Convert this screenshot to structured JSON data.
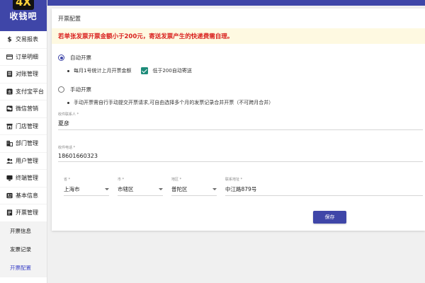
{
  "sidebar": {
    "logo_mark": "4X",
    "logo_text": "收钱吧",
    "items": [
      {
        "label": "交易报表",
        "icon": "dollar-icon"
      },
      {
        "label": "订单明细",
        "icon": "card-icon"
      },
      {
        "label": "对账管理",
        "icon": "ledger-icon"
      },
      {
        "label": "支付宝平台",
        "icon": "alipay-icon"
      },
      {
        "label": "微信营销",
        "icon": "wechat-icon"
      },
      {
        "label": "门店管理",
        "icon": "store-icon"
      },
      {
        "label": "部门管理",
        "icon": "building-icon"
      },
      {
        "label": "用户管理",
        "icon": "users-icon"
      },
      {
        "label": "终端管理",
        "icon": "terminal-icon"
      },
      {
        "label": "基本信息",
        "icon": "info-icon"
      },
      {
        "label": "开票管理",
        "icon": "invoice-icon"
      }
    ],
    "sub_items": [
      {
        "label": "开票信息"
      },
      {
        "label": "发票记录"
      },
      {
        "label": "开票配置"
      }
    ]
  },
  "card": {
    "title": "开票配置",
    "warning": "若单张发票开票金额小于200元，寄送发票产生的快递费需自理。",
    "auto": {
      "label": "自动开票",
      "bullet": "每月1号统计上月开票金额",
      "checkbox_label": "低于200自动寄送"
    },
    "manual": {
      "label": "手动开票",
      "bullet": "手动开票需自行手动提交开票请求,可自由选择多个月的发票记录合并开票（不可跨月合并）"
    },
    "contact": {
      "label": "收件联系人 *",
      "value": "夏彦"
    },
    "phone": {
      "label": "收件电话 *",
      "value": "18601660323"
    },
    "province": {
      "label": "省 *",
      "value": "上海市"
    },
    "city": {
      "label": "市 *",
      "value": "市辖区"
    },
    "district": {
      "label": "地区 *",
      "value": "普陀区"
    },
    "address": {
      "label": "联系地址 *",
      "value": "中江路879号"
    },
    "save_label": "保存"
  }
}
